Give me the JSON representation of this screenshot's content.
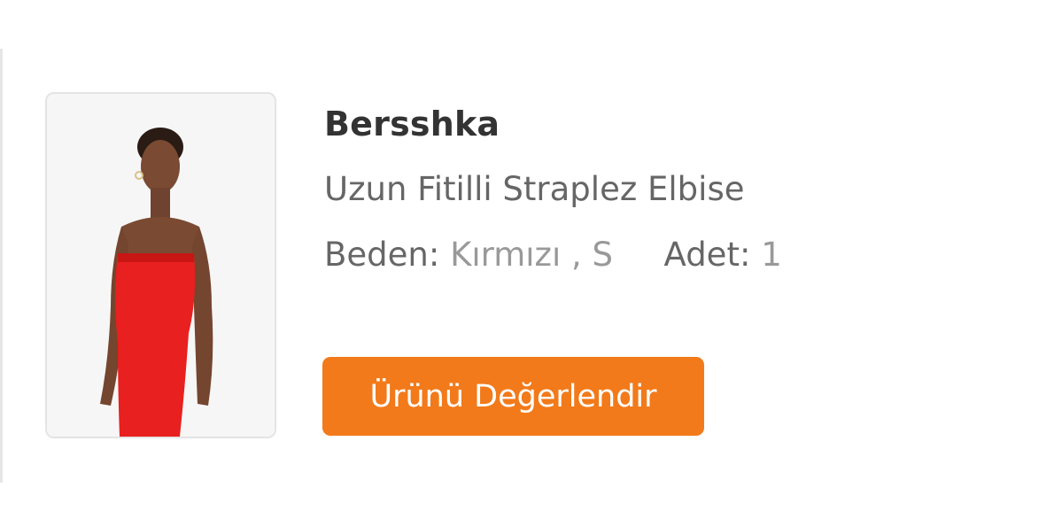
{
  "product": {
    "brand": "Bersshka",
    "name": "Uzun Fitilli Straplez Elbise",
    "size_label": "Beden:",
    "size_value": "Kırmızı , S",
    "quantity_label": "Adet:",
    "quantity_value": "1",
    "image_alt": "product-image-red-strapless-dress"
  },
  "actions": {
    "rate_label": "Ürünü Değerlendir"
  },
  "colors": {
    "accent": "#f27a1a",
    "dress": "#e8201f"
  }
}
